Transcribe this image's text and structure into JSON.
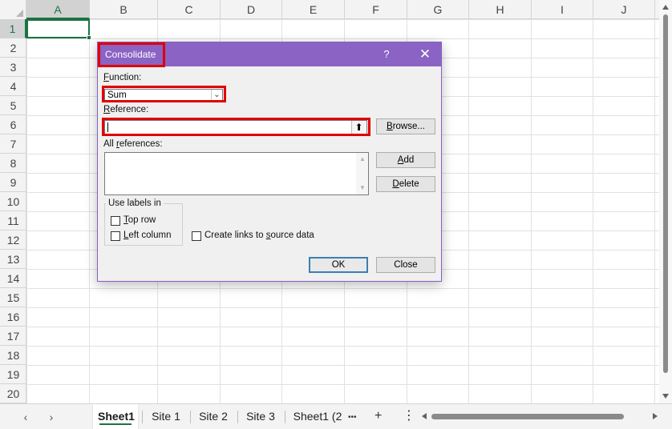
{
  "sheet": {
    "columns": [
      "A",
      "B",
      "C",
      "D",
      "E",
      "F",
      "G",
      "H",
      "I",
      "J"
    ],
    "rows": [
      "1",
      "2",
      "3",
      "4",
      "5",
      "6",
      "7",
      "8",
      "9",
      "10",
      "11",
      "12",
      "13",
      "14",
      "15",
      "16",
      "17",
      "18",
      "19",
      "20"
    ],
    "active_column": "A",
    "active_row": "1",
    "accent_color": "#1a7343"
  },
  "dialog": {
    "title": "Consolidate",
    "help": "?",
    "close": "✕",
    "title_color": "#8a63c5",
    "function_label_accel": "F",
    "function_label_rest": "unction:",
    "function_value": "Sum",
    "reference_label_accel": "R",
    "reference_label_rest": "eference:",
    "reference_value": "",
    "collapse_icon": "⬆",
    "browse_accel": "B",
    "browse_rest": "rowse...",
    "all_refs_prefix": "All ",
    "all_refs_accel": "r",
    "all_refs_rest": "eferences:",
    "add_accel": "A",
    "add_rest": "dd",
    "delete_accel": "D",
    "delete_rest": "elete",
    "use_labels_in": "Use labels in",
    "top_row_accel": "T",
    "top_row_rest": "op row",
    "left_column_accel": "L",
    "left_column_rest": "eft column",
    "create_links_prefix": "Create links to ",
    "create_links_accel": "s",
    "create_links_rest": "ource data",
    "ok_label": "OK",
    "close_label": "Close",
    "highlight_color": "#e00000"
  },
  "tabs": {
    "items": [
      {
        "label": "Sheet1",
        "active": true
      },
      {
        "label": "Site 1",
        "active": false
      },
      {
        "label": "Site 2",
        "active": false
      },
      {
        "label": "Site 3",
        "active": false
      },
      {
        "label": "Sheet1 (2",
        "active": false
      }
    ],
    "more": "•••",
    "add": "+",
    "options": "⋮",
    "prev": "‹",
    "next": "›"
  }
}
